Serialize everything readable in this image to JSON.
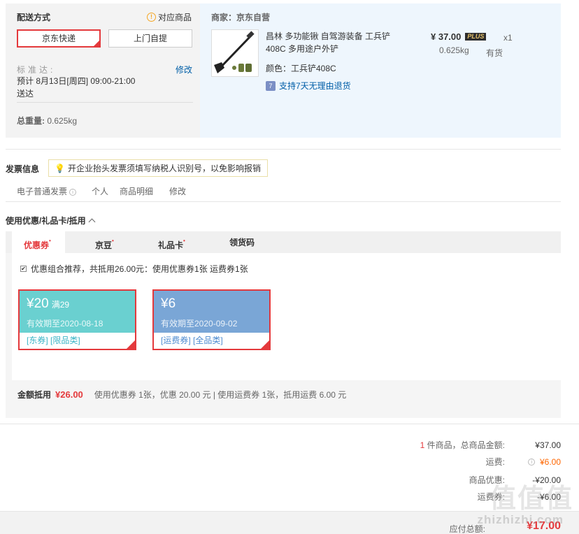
{
  "shipping": {
    "title": "配送方式",
    "match_link": "对应商品",
    "options": [
      {
        "label": "京东快递",
        "selected": true
      },
      {
        "label": "上门自提",
        "selected": false
      }
    ],
    "standard_label": "标准达:",
    "modify": "修改",
    "estimate": "预计 8月13日[周四] 09:00-21:00 送达",
    "total_weight_label": "总重量:",
    "total_weight": "0.625kg"
  },
  "product": {
    "seller": "商家：京东自营",
    "name": "昌林 多功能锹 自驾游装备 工兵铲408C 多用途户外铲",
    "color": "颜色：工兵铲408C",
    "return_policy": "支持7天无理由退货",
    "price": "¥ 37.00",
    "plus_badge": "PLUS",
    "qty": "x1",
    "weight": "0.625kg",
    "stock": "有货"
  },
  "invoice": {
    "title": "发票信息",
    "tip": "开企业抬头发票须填写纳税人识别号，以免影响报销",
    "type": "电子普通发票",
    "receiver": "个人",
    "content": "商品明细",
    "modify": "修改"
  },
  "coupons": {
    "title": "使用优惠/礼品卡/抵用",
    "tabs": [
      {
        "label": "优惠券",
        "dot": "•"
      },
      {
        "label": "京豆",
        "dot": "•"
      },
      {
        "label": "礼品卡",
        "dot": "•"
      },
      {
        "label": "领货码",
        "dot": ""
      }
    ],
    "combo_text": "优惠组合推荐，共抵用26.00元：使用优惠券1张 运费券1张",
    "items": [
      {
        "amount": "¥20",
        "condition": "满29",
        "expiry": "有效期至2020-08-18",
        "tags": "[东券]  [限品类]",
        "color": "#6ad0d0"
      },
      {
        "amount": "¥6",
        "condition": "",
        "expiry": "有效期至2020-09-02",
        "tags": "[运费券]  [全品类]",
        "color": "#7aa6d6"
      }
    ],
    "deduct_label": "金额抵用",
    "deduct_amount": "¥26.00",
    "deduct_detail": "使用优惠券 1张，优惠 20.00 元  | 使用运费券 1张，抵用运费 6.00 元"
  },
  "totals": {
    "count": "1",
    "count_label": " 件商品，总商品金额:",
    "goods_amount": "¥37.00",
    "shipping_label": "运费:",
    "shipping_amount": "¥6.00",
    "discount_label": "商品优惠:",
    "discount_amount": "-¥20.00",
    "ship_coupon_label": "运费券:",
    "ship_coupon_amount": "-¥6.00",
    "payable_label": "应付总额:",
    "payable_amount": "¥17.00"
  },
  "watermark": {
    "big": "值值值",
    "small": "zhizhizhi.com"
  }
}
